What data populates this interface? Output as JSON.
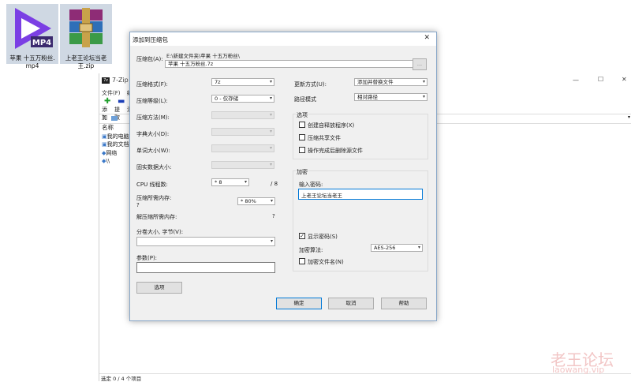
{
  "desktop": {
    "icons": [
      {
        "label": "苹果 十五万粉丝.mp4",
        "line1": "苹果 十五万粉丝.",
        "line2": "mp4",
        "badge": "MP4"
      },
      {
        "label": "上老王论坛当老王.zip",
        "line1": "上老王论坛当老",
        "line2": "王.zip"
      }
    ]
  },
  "zip_window": {
    "title": "7-Zip",
    "menu": [
      "文件(F)",
      "编"
    ],
    "toolbar": [
      "添加",
      "提取",
      "测"
    ],
    "address_arrow": "⇑",
    "list_header": "名称",
    "list_items": [
      "我的电脑",
      "我的文档",
      "网络",
      "\\\\"
    ],
    "status": "选定 0 / 4 个项目",
    "controls": {
      "minimize": "—",
      "maximize": "☐",
      "close": "✕"
    }
  },
  "dialog": {
    "title": "添加到压缩包",
    "archive_label": "压缩包(A):",
    "archive_path": "E:\\新建文件夹\\苹果 十五万粉丝\\",
    "archive_name": "苹果 十五万粉丝.7z",
    "browse_label": "...",
    "format_label": "压缩格式(F):",
    "format_value": "7z",
    "level_label": "压缩等级(L):",
    "level_value": "0 - 仅存储",
    "method_label": "压缩方法(M):",
    "dict_label": "字典大小(D):",
    "word_label": "单词大小(W):",
    "solid_label": "固实数据大小:",
    "cpu_label": "CPU 线程数:",
    "cpu_value": "* 8",
    "cpu_max": "/ 8",
    "mem_label": "压缩所需内存:",
    "mem_q": "?",
    "mem_value": "* 80%",
    "mem_value_q": "?",
    "decomp_label": "解压缩所需内存:",
    "decomp_value": "?",
    "split_label": "分卷大小, 字节(V):",
    "params_label": "参数(P):",
    "options_button": "选项",
    "update_label": "更新方式(U):",
    "update_value": "添加并替换文件",
    "pathmode_label": "路径模式",
    "pathmode_value": "相对路径",
    "options_group": "选项",
    "opt_sfx": "创建自释放程序(X)",
    "opt_shared": "压缩共享文件",
    "opt_delete": "操作完成后删除源文件",
    "encrypt_group": "加密",
    "password_label": "输入密码:",
    "password_value": "上老王论坛当老王",
    "show_password": "显示密码(S)",
    "show_password_checked": "✓",
    "enc_method_label": "加密算法:",
    "enc_method_value": "AES-256",
    "encrypt_names": "加密文件名(N)",
    "ok": "确定",
    "cancel": "取消",
    "help": "帮助",
    "close": "✕"
  },
  "watermark": {
    "cn": "老王论坛",
    "en": "laowang.vip"
  }
}
